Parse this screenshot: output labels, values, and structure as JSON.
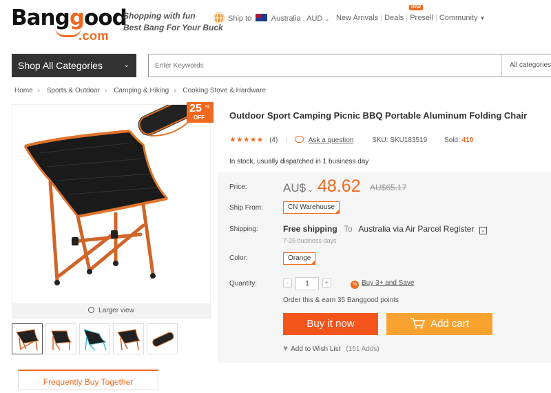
{
  "header": {
    "logo_part1": "Bang",
    "logo_part2": "g",
    "logo_part3": "ood",
    "logo_com": ".com",
    "slogan_line1": "Shopping with fun",
    "slogan_line2": "Best Bang For Your Buck",
    "ship_to": "Ship to",
    "country": "Australia",
    "currency": "AUD",
    "nav": [
      "New Arrivals",
      "Deals",
      "Presell",
      "Community"
    ],
    "new_badge": "NEW"
  },
  "search": {
    "categories_button": "Shop All Categories",
    "placeholder": "Enter Keywords",
    "scope": "All categories"
  },
  "breadcrumb": [
    "Home",
    "Sports & Outdoor",
    "Camping & Hiking",
    "Cooking Stove & Hardware"
  ],
  "gallery": {
    "discount_value": "25",
    "discount_pct": "%",
    "discount_off": "OFF",
    "larger_view": "Larger view",
    "thumbnail_count": 5
  },
  "product": {
    "title": "Outdoor Sport Camping Picnic BBQ Portable Aluminum Folding Chair",
    "stars": "★★★★★",
    "rating_value": 5,
    "review_count": "(4)",
    "ask_question": "Ask a question",
    "sku_label": "SKU:",
    "sku": "SKU183519",
    "sold_label": "Sold:",
    "sold": "410",
    "stock": "In stock, usually dispatched in 1 business day"
  },
  "purchase": {
    "price_label": "Price:",
    "currency_label": "AU$",
    "price": "48.62",
    "old_price": "AU$65.17",
    "ship_from_label": "Ship From:",
    "ship_from": "CN Warehouse",
    "shipping_label": "Shipping:",
    "free_shipping": "Free shipping",
    "to": "To",
    "destination": "Australia via Air Parcel Register",
    "delivery_time": "7-25 business days",
    "color_label": "Color:",
    "color": "Orange",
    "quantity_label": "Quantity:",
    "quantity": "1",
    "buy3_badge": "%",
    "buy3": "Buy 3+ and Save",
    "points": "Order this & earn 35 Banggood points",
    "buy_now": "Buy it now",
    "add_cart": "Add cart",
    "wishlist": "Add to Wish List",
    "wishlist_count": "(151 Adds)"
  },
  "tabs": {
    "frequently": "Frequently Buy Together"
  },
  "colors": {
    "accent": "#f1691f",
    "buy_now": "#f5541a",
    "add_cart": "#f9a22f",
    "dark": "#333333"
  }
}
